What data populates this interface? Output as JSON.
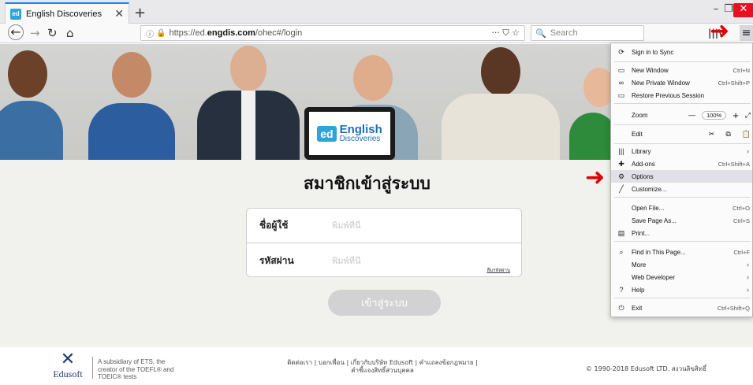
{
  "tab": {
    "favicon": "ed",
    "title": "English Discoveries",
    "close": "✕",
    "new_tab": "+"
  },
  "window": {
    "minimize": "–",
    "restore": "❐",
    "close": "✕"
  },
  "nav": {
    "back": "←",
    "forward": "→",
    "reload": "↻",
    "home": "⌂",
    "url_prefix": "https://ed.",
    "url_domain": "engdis.com",
    "url_path": "/ohec#/login",
    "page_actions": "··· ⛉ ☆",
    "search_placeholder": "Search",
    "library": "|||\\",
    "menu": "≡"
  },
  "hero": {
    "logo_badge": "ed",
    "logo_line1": "English",
    "logo_line2": "Discoveries"
  },
  "login": {
    "title": "สมาชิกเข้าสู่ระบบ",
    "username_label": "ชื่อผู้ใช้",
    "username_placeholder": "พิมพ์ที่นี่",
    "password_label": "รหัสผ่าน",
    "password_placeholder": "พิมพ์ที่นี่",
    "forgot": "ลืมรหัสผ่าน",
    "submit": "เข้าสู่ระบบ"
  },
  "footer": {
    "logo_text": "Edusoft",
    "subsidiary": "A subsidiary of ETS, the creator of the TOEFL® and TOEIC® tests",
    "links_line1": "ติดต่อเรา | บอกเพื่อน | เกี่ยวกับบริษัท Edusoft | คำแถลงข้อกฎหมาย |",
    "links_line2": "คำชี้แจงสิทธิ์ส่วนบุคคล",
    "copyright": "© 1990-2018 Edusoft LTD. สงวนลิขสิทธิ์"
  },
  "menu": {
    "sign_in": "Sign in to Sync",
    "new_window": "New Window",
    "new_window_sc": "Ctrl+N",
    "private_window": "New Private Window",
    "private_window_sc": "Ctrl+Shift+P",
    "restore_session": "Restore Previous Session",
    "zoom": "Zoom",
    "zoom_minus": "—",
    "zoom_value": "100%",
    "zoom_plus": "+",
    "zoom_full": "⤢",
    "edit": "Edit",
    "cut": "✂",
    "copy": "⧉",
    "paste": "📋",
    "library": "Library",
    "addons": "Add-ons",
    "addons_sc": "Ctrl+Shift+A",
    "options": "Options",
    "customize": "Customize...",
    "open_file": "Open File...",
    "open_file_sc": "Ctrl+O",
    "save_page": "Save Page As...",
    "save_page_sc": "Ctrl+S",
    "print": "Print...",
    "find": "Find in This Page...",
    "find_sc": "Ctrl+F",
    "more": "More",
    "web_dev": "Web Developer",
    "help": "Help",
    "exit": "Exit",
    "exit_sc": "Ctrl+Shift+Q",
    "chevron": "›"
  },
  "colors": {
    "accent": "#0a84ff",
    "arrow": "#e00000",
    "ed_blue": "#2fa4d8",
    "edusoft_navy": "#1d3b6e"
  }
}
